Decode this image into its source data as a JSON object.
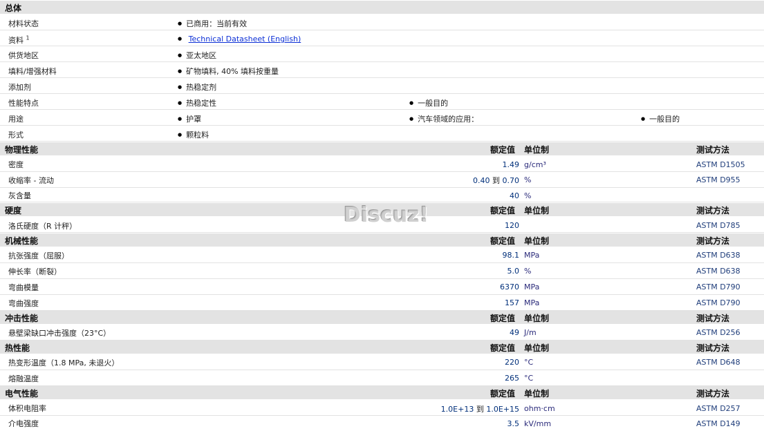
{
  "general": {
    "header": "总体",
    "rows": [
      {
        "label": "材料状态",
        "values": [
          "已商用：当前有效"
        ]
      },
      {
        "label": "资料",
        "sup": "1",
        "link": "Technical Datasheet (English)"
      },
      {
        "label": "供货地区",
        "values": [
          "亚太地区"
        ]
      },
      {
        "label": "填料/增强材料",
        "values": [
          "矿物填料, 40% 填料按重量"
        ]
      },
      {
        "label": "添加剂",
        "values": [
          "热稳定剂"
        ]
      },
      {
        "label": "性能特点",
        "values": [
          "热稳定性",
          "一般目的"
        ]
      },
      {
        "label": "用途",
        "values": [
          "护罩",
          "汽车领域的应用：",
          "一般目的"
        ]
      },
      {
        "label": "形式",
        "values": [
          "颗粒料"
        ]
      }
    ]
  },
  "col_headers": {
    "nominal": "额定值",
    "unit": "单位制",
    "method": "测试方法"
  },
  "sections": [
    {
      "title": "物理性能",
      "rows": [
        {
          "label": "密度",
          "value": "1.49",
          "unit": "g/cm³",
          "method": "ASTM D1505"
        },
        {
          "label": "收缩率  - 流动",
          "value_lo": "0.40",
          "to": "到",
          "value": "0.70",
          "unit": "%",
          "method": "ASTM D955"
        },
        {
          "label": "灰含量",
          "value": "40",
          "unit": "%",
          "method": ""
        }
      ]
    },
    {
      "title": "硬度",
      "rows": [
        {
          "label": "洛氏硬度（R 计秤）",
          "value": "120",
          "unit": "",
          "method": "ASTM D785"
        }
      ]
    },
    {
      "title": "机械性能",
      "rows": [
        {
          "label": "抗张强度（屈服）",
          "value": "98.1",
          "unit": "MPa",
          "method": "ASTM D638"
        },
        {
          "label": "伸长率（断裂）",
          "value": "5.0",
          "unit": "%",
          "method": "ASTM D638"
        },
        {
          "label": "弯曲模量",
          "value": "6370",
          "unit": "MPa",
          "method": "ASTM D790"
        },
        {
          "label": "弯曲强度",
          "value": "157",
          "unit": "MPa",
          "method": "ASTM D790"
        }
      ]
    },
    {
      "title": "冲击性能",
      "rows": [
        {
          "label": "悬壁梁缺口冲击强度（23°C）",
          "value": "49",
          "unit": "J/m",
          "method": "ASTM D256"
        }
      ]
    },
    {
      "title": "热性能",
      "rows": [
        {
          "label": "热变形温度（1.8 MPa, 未退火）",
          "value": "220",
          "unit": "°C",
          "method": "ASTM D648"
        },
        {
          "label": "熔融温度",
          "value": "265",
          "unit": "°C",
          "method": ""
        }
      ]
    },
    {
      "title": "电气性能",
      "rows": [
        {
          "label": "体积电阻率",
          "value_lo": "1.0E+13",
          "to": "到",
          "value": "1.0E+15",
          "unit": "ohm·cm",
          "method": "ASTM D257"
        },
        {
          "label": "介电强度",
          "value": "3.5",
          "unit": "kV/mm",
          "method": "ASTM D149"
        }
      ]
    }
  ],
  "watermark": "Discuz!"
}
